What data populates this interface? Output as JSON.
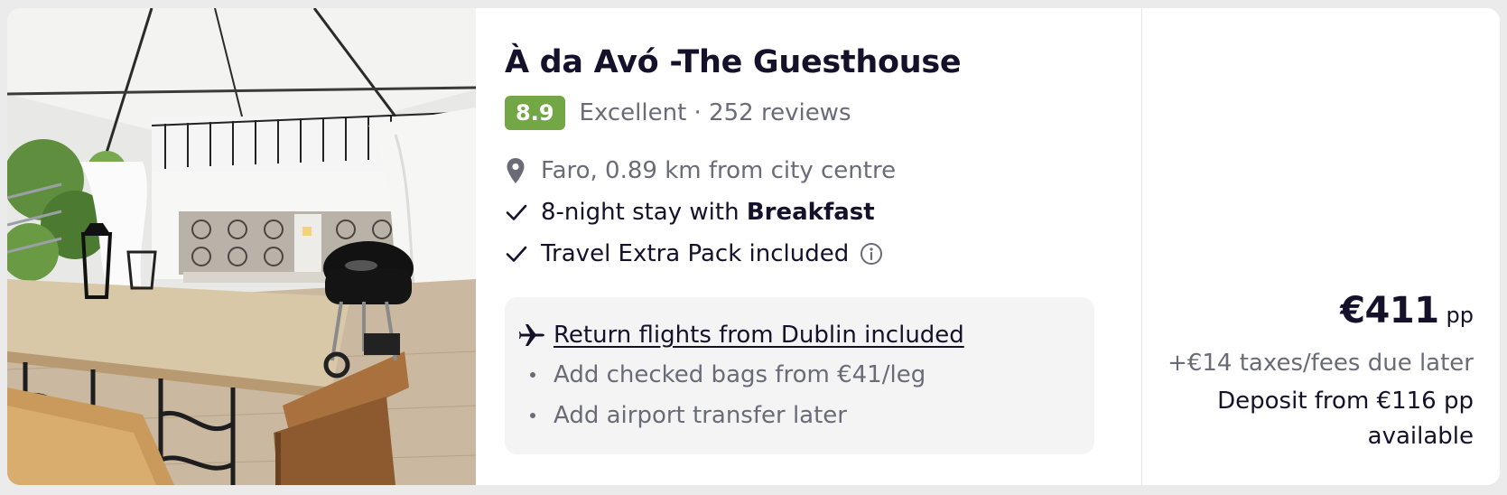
{
  "hotel": {
    "name": "À da Avó -The Guesthouse",
    "score": "8.9",
    "rating_text": "Excellent · 252 reviews",
    "location": "Faro, 0.89 km from city centre",
    "photo_icon": "courtyard-photo"
  },
  "features": {
    "stay_prefix": "8-night stay with ",
    "stay_board": "Breakfast",
    "extra_pack": "Travel Extra Pack included"
  },
  "flights": {
    "link": "Return flights from Dublin included",
    "bags": "Add checked bags from €41/leg",
    "transfer": "Add airport transfer later"
  },
  "pricing": {
    "amount": "€411",
    "unit": "pp",
    "taxes": "+€14 taxes/fees due later",
    "deposit": "Deposit from €116 pp available"
  },
  "colors": {
    "score_badge": "#73a746",
    "text_primary": "#15112b",
    "text_secondary": "#6b6b78",
    "flight_box_bg": "#f4f4f5"
  },
  "icons": [
    "location-pin-icon",
    "check-icon",
    "info-icon",
    "plane-icon"
  ]
}
